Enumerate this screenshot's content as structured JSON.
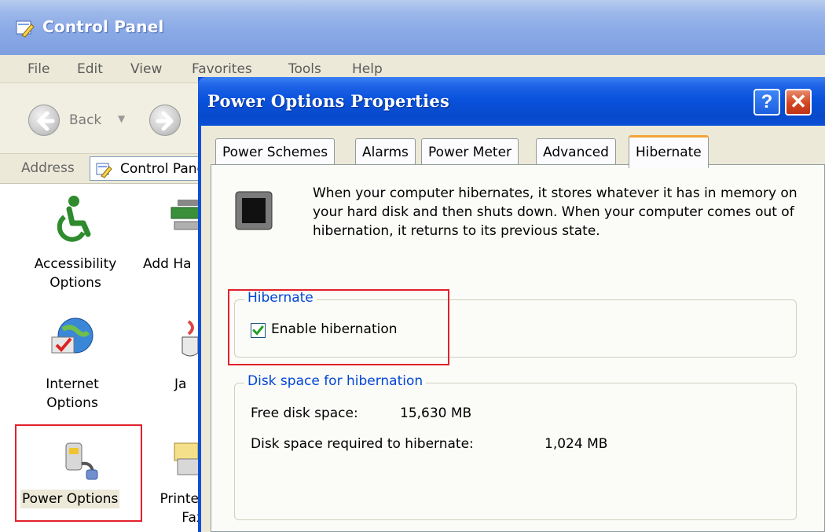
{
  "control_panel": {
    "title": "Control Panel",
    "menu": [
      "File",
      "Edit",
      "View",
      "Favorites",
      "Tools",
      "Help"
    ],
    "toolbar": {
      "back_label": "Back"
    },
    "address": {
      "label": "Address",
      "value": "Control Panel"
    },
    "items": [
      {
        "label": "Accessibility\nOptions",
        "icon": "accessibility-icon"
      },
      {
        "label": "Add Ha",
        "icon": "add-hardware-icon"
      },
      {
        "label": "Internet\nOptions",
        "icon": "internet-options-icon"
      },
      {
        "label": "Ja",
        "icon": "java-icon"
      },
      {
        "label": "Power Options",
        "icon": "power-options-icon",
        "selected": true
      },
      {
        "label": "Printer\nFax",
        "icon": "printers-icon"
      }
    ]
  },
  "dialog": {
    "title": "Power Options Properties",
    "tabs": [
      "Power Schemes",
      "Alarms",
      "Power Meter",
      "Advanced",
      "Hibernate"
    ],
    "active_tab": "Hibernate",
    "description": "When your computer hibernates, it stores whatever it has in memory on your hard disk and then shuts down. When your computer comes out of hibernation, it returns to its previous state.",
    "hibernate_group": {
      "legend": "Hibernate",
      "checkbox_label": "Enable hibernation",
      "checked": true
    },
    "disk_group": {
      "legend": "Disk space for hibernation",
      "free_label": "Free disk space:",
      "free_value": "15,630 MB",
      "required_label": "Disk space required to hibernate:",
      "required_value": "1,024 MB"
    }
  },
  "colors": {
    "annotation_box": "#e3202b",
    "xp_title_blue": "#0a4fd8",
    "group_legend": "#0046d5"
  }
}
